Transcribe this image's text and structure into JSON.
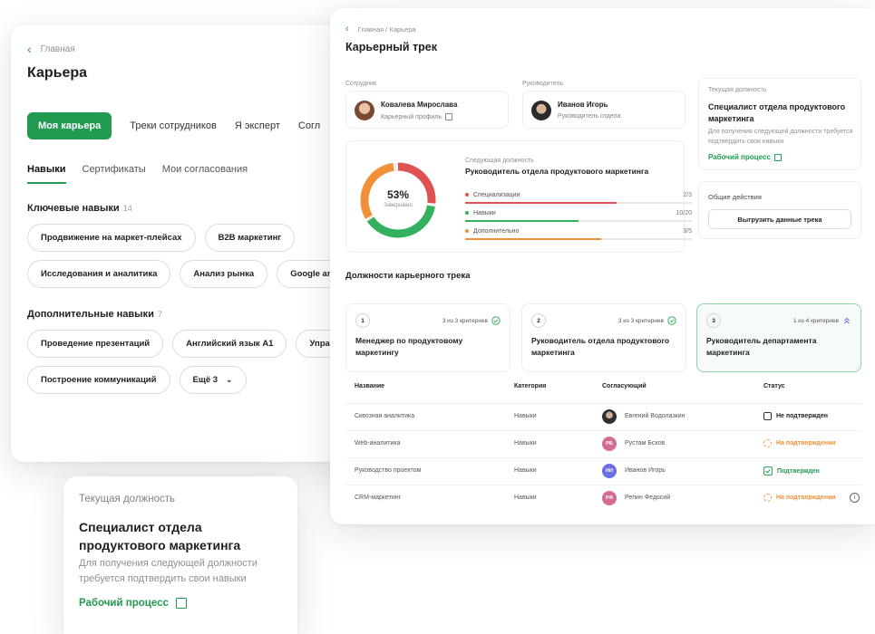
{
  "back": {
    "breadcrumb": "Главная",
    "title": "Карьера",
    "tabs": [
      "Моя карьера",
      "Треки сотрудников",
      "Я эксперт",
      "Согл"
    ],
    "subtabs": [
      "Навыки",
      "Сертификаты",
      "Мои согласования"
    ],
    "key_skills": {
      "title": "Ключевые навыки",
      "count": "14",
      "row1": [
        "Продвижение на маркет-плейсах",
        "B2B маркетинг"
      ],
      "row2": [
        "Исследования и аналитика",
        "Анализ рынка",
        "Google analyt"
      ]
    },
    "extra_skills": {
      "title": "Дополнительные навыки",
      "count": "7",
      "row1": [
        "Проведение презентаций",
        "Английский язык A1",
        "Управлен"
      ],
      "row2": [
        "Построение коммуникаций"
      ],
      "more": "Ещё 3"
    }
  },
  "front": {
    "breadcrumb": "Главная / Карьера",
    "title": "Карьерный трек",
    "employee_label": "Сотрудник",
    "employee_name": "Ковалева Мирослава",
    "employee_link": "Карьерный профиль",
    "manager_label": "Руководитель",
    "manager_name": "Иванов Игорь",
    "manager_role": "Руководитель отдела",
    "current": {
      "label": "Текущая должность",
      "title": "Специалист отдела продуктового маркетинга",
      "desc": "Для получения следующей должности требуется подтвердить свои навыки",
      "link": "Рабочий процесс"
    },
    "actions": {
      "label": "Общие действия",
      "button": "Выгрузить данные трека"
    },
    "next": {
      "label": "Следующая должность",
      "title": "Руководитель отдела продуктового маркетинга",
      "percent": "53%",
      "percent_label": "Завершено",
      "rows": [
        {
          "name": "Специализации",
          "value": "2/3",
          "fraction": 0.667,
          "color": "#e05252"
        },
        {
          "name": "Навыки",
          "value": "10/20",
          "fraction": 0.5,
          "color": "#33b15e"
        },
        {
          "name": "Дополнительно",
          "value": "3/5",
          "fraction": 0.6,
          "color": "#f0913a"
        }
      ]
    },
    "positions_title": "Должности карьерного трека",
    "positions": [
      {
        "num": "1",
        "criteria": "3 из 3 критериев",
        "name": "Менеджер по продуктовому маркетингу"
      },
      {
        "num": "2",
        "criteria": "3 из 3 критериев",
        "name": "Руководитель отдела продуктового маркетинга"
      },
      {
        "num": "3",
        "criteria": "1 из 4 критериев",
        "name": "Руководитель департамента маркетинга"
      }
    ],
    "table": {
      "headers": [
        "Название",
        "Категория",
        "Согласующий",
        "Статус"
      ],
      "rows": [
        {
          "name": "Сквозная аналитика",
          "category": "Навыки",
          "initials": "",
          "approver": "Евгений Водолазкин",
          "status": "Не подтвержден",
          "status_color": "#222222",
          "av_color": "#3b3b3b"
        },
        {
          "name": "Web-аналитика",
          "category": "Навыки",
          "initials": "РБ",
          "approver": "Рустам Бсков",
          "status": "На подтверждении",
          "status_color": "#f0913a",
          "av_color": "#d46b92"
        },
        {
          "name": "Руководство проектом",
          "category": "Навыки",
          "initials": "ИИ",
          "approver": "Иванов Игорь",
          "status": "Подтвержден",
          "status_color": "#239a52",
          "av_color": "#6b6ee6"
        },
        {
          "name": "CRM-маркетинг",
          "category": "Навыки",
          "initials": "РФ",
          "approver": "Репин Федосий",
          "status": "На подтверждении",
          "status_color": "#f0913a",
          "av_color": "#d46b92"
        }
      ]
    }
  },
  "mini": {
    "label": "Текущая должность",
    "title": "Специалист отдела продуктового маркетинга",
    "desc": "Для получения следующей должности требуется подтвердить свои  навыки",
    "link": "Рабочий процесс"
  }
}
